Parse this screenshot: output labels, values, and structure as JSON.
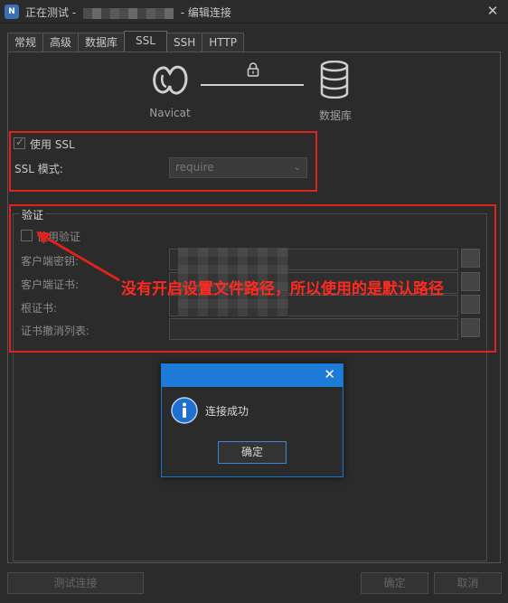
{
  "window": {
    "title_prefix": "正在测试 - ",
    "title_suffix": " - 编辑连接",
    "close_glyph": "✕"
  },
  "tabs": [
    {
      "label": "常规"
    },
    {
      "label": "高级"
    },
    {
      "label": "数据库"
    },
    {
      "label": "SSL",
      "active": true
    },
    {
      "label": "SSH"
    },
    {
      "label": "HTTP"
    }
  ],
  "diagram": {
    "client_label": "Navicat",
    "server_label": "数据库"
  },
  "ssl": {
    "use_ssl_label": "使用 SSL",
    "use_ssl_checked": true,
    "mode_label": "SSL 模式:",
    "mode_value": "require"
  },
  "auth": {
    "group_title": "验证",
    "use_auth_label": "使用验证",
    "use_auth_checked": false,
    "client_key_label": "客户端密钥:",
    "client_cert_label": "客户端证书:",
    "ca_cert_label": "根证书:",
    "crl_label": "证书撤消列表:"
  },
  "annotation": {
    "text": "没有开启设置文件路径，所以使用的是默认路径",
    "color": "#e0221d"
  },
  "dialog": {
    "message": "连接成功",
    "ok_label": "确定",
    "close_glyph": "✕"
  },
  "footer": {
    "test_label": "测试连接",
    "ok_label": "确定",
    "cancel_label": "取消"
  },
  "colors": {
    "accent": "#1f7bd8",
    "background": "#2b2b2b"
  }
}
